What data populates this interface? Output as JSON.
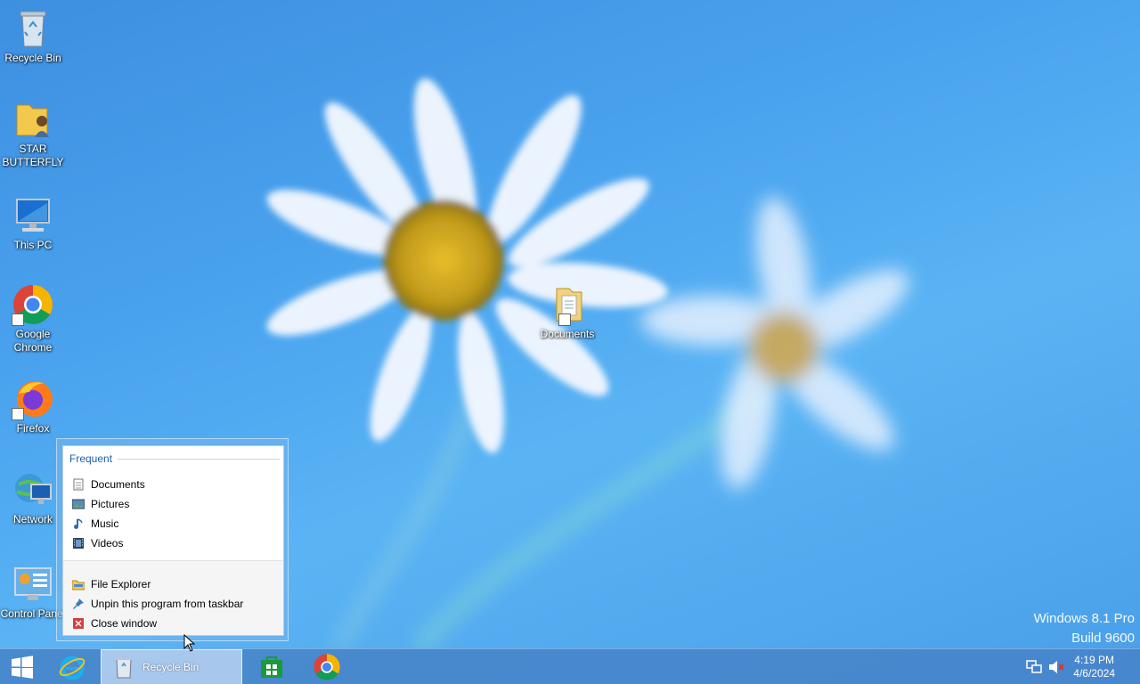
{
  "desktop": {
    "icons": [
      {
        "label": "Recycle Bin"
      },
      {
        "label": "STAR BUTTERFLY"
      },
      {
        "label": "This PC"
      },
      {
        "label": "Google Chrome"
      },
      {
        "label": "Firefox"
      },
      {
        "label": "Network"
      },
      {
        "label": "Control Panel"
      },
      {
        "label": "Documents"
      }
    ],
    "watermark": {
      "line1": "Windows 8.1 Pro",
      "line2": "Build 9600"
    }
  },
  "jumplist": {
    "header": "Frequent",
    "frequent": [
      {
        "label": "Documents",
        "icon": "document-icon"
      },
      {
        "label": "Pictures",
        "icon": "pictures-icon"
      },
      {
        "label": "Music",
        "icon": "music-icon"
      },
      {
        "label": "Videos",
        "icon": "videos-icon"
      }
    ],
    "tasks": [
      {
        "label": "File Explorer",
        "icon": "folder-icon"
      },
      {
        "label": "Unpin this program from taskbar",
        "icon": "pin-icon"
      },
      {
        "label": "Close window",
        "icon": "close-icon"
      }
    ]
  },
  "taskbar": {
    "active_label": "Recycle Bin",
    "clock_time": "4:19 PM",
    "clock_date": "4/6/2024"
  },
  "colors": {
    "accent": "#1f5fa8",
    "taskbar": "#4682c8",
    "desktop": "#4aa3ee"
  }
}
